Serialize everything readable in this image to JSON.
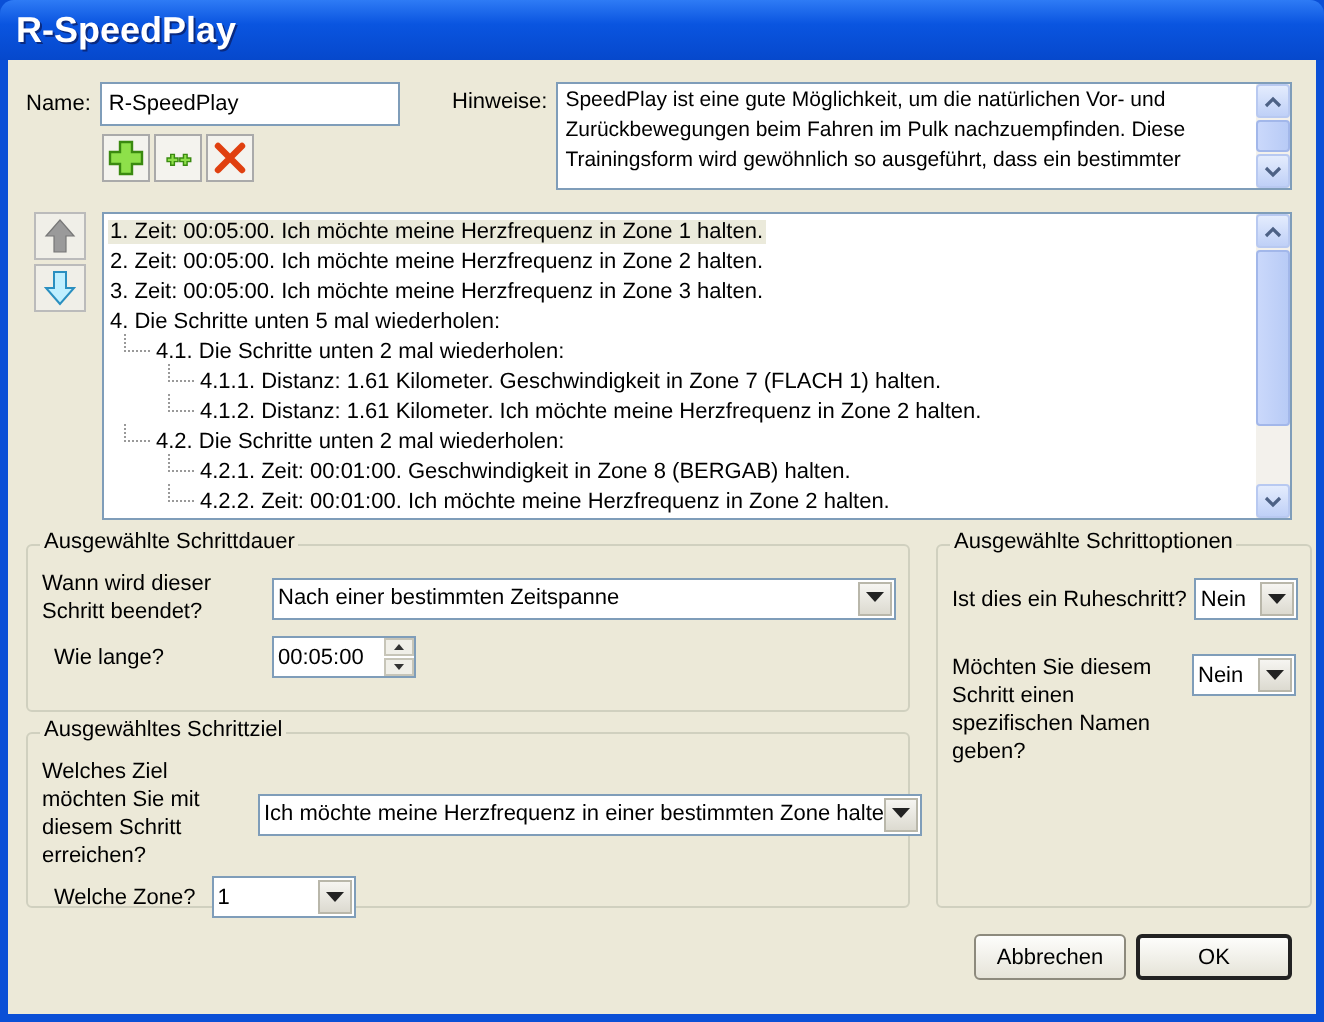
{
  "window": {
    "title": "R-SpeedPlay"
  },
  "name_field": {
    "label": "Name:",
    "value": "R-SpeedPlay"
  },
  "notes": {
    "label": "Hinweise:",
    "value": "SpeedPlay ist eine gute Möglichkeit, um die natürlichen Vor- und Zurückbewegungen beim Fahren im Pulk nachzuempfinden. Diese Trainingsform wird gewöhnlich so ausgeführt, dass ein bestimmter"
  },
  "steps": [
    {
      "text": "1. Zeit: 00:05:00. Ich möchte meine Herzfrequenz in Zone 1 halten.",
      "selected": true
    },
    {
      "text": "2. Zeit: 00:05:00. Ich möchte meine Herzfrequenz in Zone 2 halten.",
      "selected": false
    },
    {
      "text": "3. Zeit: 00:05:00. Ich möchte meine Herzfrequenz in Zone 3 halten.",
      "selected": false
    },
    {
      "text": "4. Die Schritte unten 5 mal wiederholen:",
      "selected": false,
      "children": [
        {
          "text": "4.1. Die Schritte unten 2 mal wiederholen:",
          "selected": false,
          "children": [
            {
              "text": "4.1.1. Distanz: 1.61 Kilometer. Geschwindigkeit in Zone 7 (FLACH 1) halten.",
              "selected": false
            },
            {
              "text": "4.1.2. Distanz: 1.61 Kilometer. Ich möchte meine Herzfrequenz in Zone 2 halten.",
              "selected": false
            }
          ]
        },
        {
          "text": "4.2. Die Schritte unten 2 mal wiederholen:",
          "selected": false,
          "children": [
            {
              "text": "4.2.1. Zeit: 00:01:00. Geschwindigkeit in Zone 8 (BERGAB) halten.",
              "selected": false
            },
            {
              "text": "4.2.2. Zeit: 00:01:00. Ich möchte meine Herzfrequenz in Zone 2 halten.",
              "selected": false
            }
          ]
        }
      ]
    }
  ],
  "duration_group": {
    "title": "Ausgewählte Schrittdauer",
    "end_label": "Wann wird dieser Schritt beendet?",
    "end_value": "Nach einer bestimmten Zeitspanne",
    "length_label": "Wie lange?",
    "length_value": "00:05:00"
  },
  "target_group": {
    "title": "Ausgewähltes Schrittziel",
    "goal_label": "Welches Ziel möchten Sie mit diesem Schritt erreichen?",
    "goal_value": "Ich möchte meine Herzfrequenz in einer bestimmten Zone halte",
    "zone_label": "Welche Zone?",
    "zone_value": "1"
  },
  "options_group": {
    "title": "Ausgewählte Schrittoptionen",
    "rest_label": "Ist dies ein Ruheschritt?",
    "rest_value": "Nein",
    "name_label": "Möchten Sie diesem Schritt einen spezifischen Namen geben?",
    "name_value": "Nein"
  },
  "buttons": [
    {
      "label": "Abbrechen",
      "default": false
    },
    {
      "label": "OK",
      "default": true
    }
  ]
}
